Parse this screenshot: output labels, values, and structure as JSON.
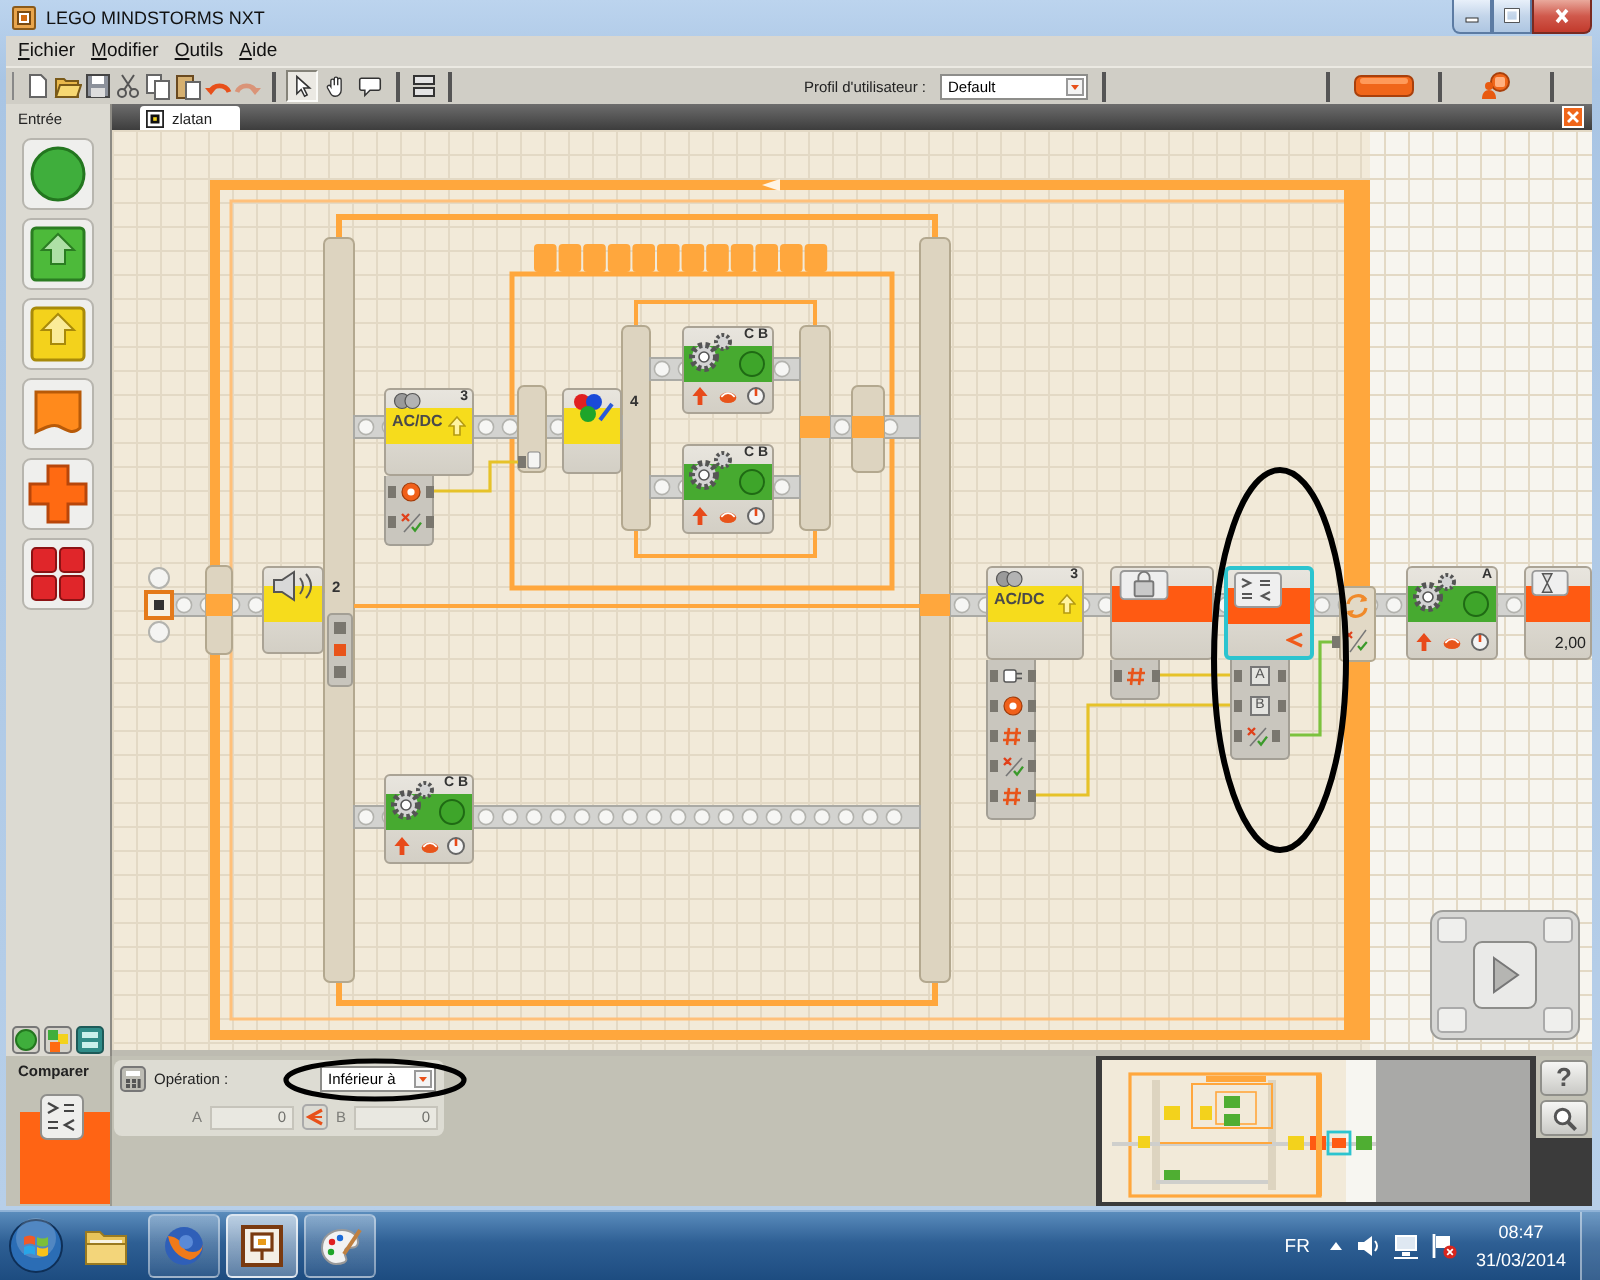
{
  "window": {
    "title": "LEGO MINDSTORMS NXT"
  },
  "menu": [
    {
      "label": "Fichier"
    },
    {
      "label": "Modifier"
    },
    {
      "label": "Outils"
    },
    {
      "label": "Aide"
    }
  ],
  "toolbar": {
    "actions": [
      {
        "kind": "new",
        "disabled": false
      },
      {
        "kind": "open",
        "disabled": false
      },
      {
        "kind": "save",
        "disabled": false
      },
      {
        "kind": "cut",
        "disabled": false
      },
      {
        "kind": "copy",
        "disabled": false
      },
      {
        "kind": "paste",
        "disabled": false
      },
      {
        "kind": "undo",
        "disabled": false
      },
      {
        "kind": "redo",
        "disabled": true
      }
    ],
    "tools": [
      {
        "kind": "pointer",
        "selected": true
      },
      {
        "kind": "pan",
        "selected": false
      },
      {
        "kind": "comment",
        "selected": false
      }
    ],
    "profile": {
      "label": "Profil d'utilisateur :",
      "value": "Default"
    }
  },
  "palette": {
    "title": "Entrée",
    "items": [
      {
        "kind": "circle"
      },
      {
        "kind": "arrow"
      },
      {
        "kind": "sensor-arrow"
      },
      {
        "kind": "flag"
      },
      {
        "kind": "cross"
      },
      {
        "kind": "grid"
      }
    ],
    "tabs": [
      {
        "kind": "common"
      },
      {
        "kind": "complete"
      },
      {
        "kind": "custom"
      }
    ]
  },
  "program": {
    "tab": {
      "label": "zlatan",
      "selected": true
    },
    "switches": [
      {
        "kind": "sound",
        "port": "2"
      },
      {
        "kind": "color",
        "port": "4"
      }
    ],
    "blocks": [
      {
        "kind": "sensor",
        "label": "AC/DC",
        "port": "3",
        "selected": false,
        "hub": [
          {
            "kind": "sensor"
          },
          {
            "kind": "logic"
          }
        ]
      },
      {
        "kind": "motor",
        "port": "C B",
        "selected": false
      },
      {
        "kind": "motor",
        "port": "C B",
        "selected": false
      },
      {
        "kind": "motor",
        "port": "C B",
        "selected": false
      },
      {
        "kind": "sensor",
        "label": "AC/DC",
        "port": "3",
        "selected": false,
        "hub": [
          {
            "kind": "power"
          },
          {
            "kind": "sensor"
          },
          {
            "kind": "number"
          },
          {
            "kind": "logic"
          },
          {
            "kind": "number"
          }
        ]
      },
      {
        "kind": "variable",
        "selected": false,
        "hub": [
          {
            "kind": "number"
          }
        ]
      },
      {
        "kind": "compare",
        "selected": true,
        "hub": [
          {
            "kind": "letter",
            "label": "A"
          },
          {
            "kind": "letter",
            "label": "B"
          },
          {
            "kind": "logic"
          }
        ]
      },
      {
        "kind": "motor",
        "port": "A",
        "selected": false
      },
      {
        "kind": "wait",
        "value": "2,00",
        "selected": false
      }
    ]
  },
  "properties": {
    "title": "Comparer",
    "operation_label": "Opération :",
    "operation_value": "Inférieur à",
    "fields": [
      {
        "label": "A",
        "value": "0",
        "disabled": true
      },
      {
        "label": "B",
        "value": "0",
        "disabled": true
      }
    ],
    "help_label": "?"
  },
  "taskbar": {
    "apps": [
      {
        "kind": "explorer",
        "running": false,
        "selected": false
      },
      {
        "kind": "firefox",
        "running": true,
        "selected": false
      },
      {
        "kind": "nxt",
        "running": true,
        "selected": true
      },
      {
        "kind": "paint",
        "running": true,
        "selected": false
      }
    ],
    "language": "FR",
    "time": "08:47",
    "date": "31/03/2014"
  }
}
